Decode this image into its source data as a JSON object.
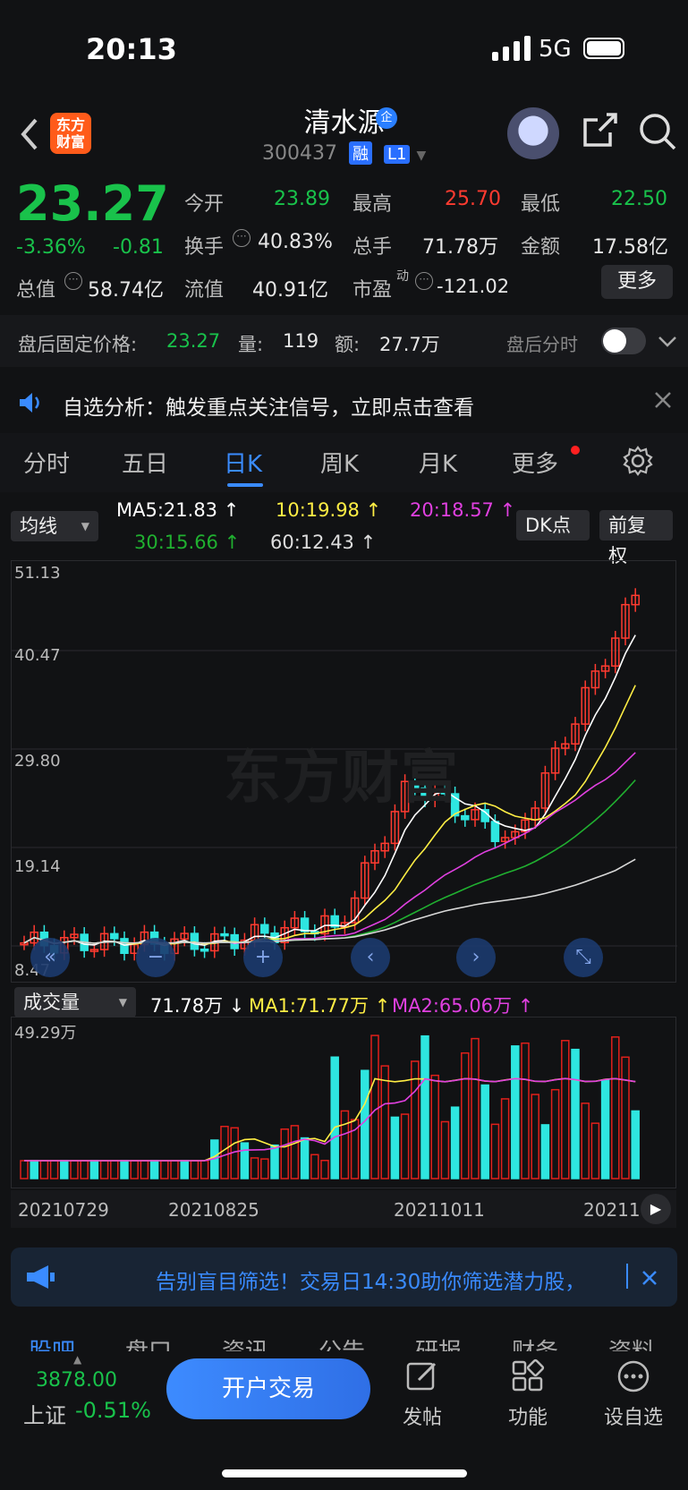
{
  "status_bar": {
    "time": "20:13",
    "network": "5G"
  },
  "header": {
    "logo_text_1": "东方",
    "logo_text_2": "财富",
    "stock_name": "清水源",
    "name_badge": "企",
    "code": "300437",
    "tag_margin": "融",
    "tag_level": "L1"
  },
  "quote": {
    "price": "23.27",
    "change_pct": "-3.36%",
    "change_abs": "-0.81",
    "open_label": "今开",
    "open": "23.89",
    "high_label": "最高",
    "high": "25.70",
    "low_label": "最低",
    "low": "22.50",
    "turnover_label": "换手",
    "turnover": "40.83%",
    "volume_label": "总手",
    "volume": "71.78万",
    "amount_label": "金额",
    "amount": "17.58亿",
    "mktcap_label": "总值",
    "mktcap": "58.74亿",
    "float_label": "流值",
    "float": "40.91亿",
    "pe_label": "市盈",
    "pe_sup": "动",
    "pe": "-121.02",
    "more_button": "更多"
  },
  "after_hours": {
    "price_label": "盘后固定价格:",
    "price": "23.27",
    "vol_label": "量:",
    "vol": "119",
    "amt_label": "额:",
    "amt": "27.7万",
    "toggle_label": "盘后分时"
  },
  "notice": {
    "text": "自选分析：触发重点关注信号，立即点击查看"
  },
  "tabs": [
    "分时",
    "五日",
    "日K",
    "周K",
    "月K",
    "更多"
  ],
  "ma_bar": {
    "selector": "均线",
    "ma5": "MA5:21.83 ↑",
    "ma10": "10:19.98 ↑",
    "ma20": "20:18.57 ↑",
    "ma30": "30:15.66 ↑",
    "ma60": "60:12.43 ↑",
    "dk_button": "DK点",
    "adjust_button": "前复权"
  },
  "watermark": "东方财富",
  "kline_axis": [
    "51.13",
    "40.47",
    "29.80",
    "19.14",
    "8.47"
  ],
  "volume_bar": {
    "selector": "成交量",
    "vol": "71.78万 ↓",
    "ma1": "MA1:71.77万 ↑",
    "ma2": "MA2:65.06万 ↑",
    "axis_top": "49.29万"
  },
  "dates": [
    "20210729",
    "20210825",
    "20211011",
    "20211"
  ],
  "banner": {
    "text": "告别盲目筛选！交易日14:30助你筛选潜力股，"
  },
  "bottom_tabs": [
    "股吧",
    "盘口",
    "资讯",
    "公告",
    "研报",
    "财务",
    "资料"
  ],
  "index": {
    "value": "3878.00",
    "name": "上证",
    "change": "-0.51%"
  },
  "bottom": {
    "trade_button": "开户交易",
    "post": "发帖",
    "function": "功能",
    "watchlist": "设自选"
  },
  "colors": {
    "up": "#ff3b30",
    "down": "#19c24b",
    "accent": "#3a8bff",
    "ma5": "#ffffff",
    "ma10": "#ffee44",
    "ma20": "#e040e0",
    "ma30": "#20b030",
    "ma60": "#d8d8d8",
    "vol_up": "#e0201b",
    "vol_down": "#2ee6e0"
  }
}
